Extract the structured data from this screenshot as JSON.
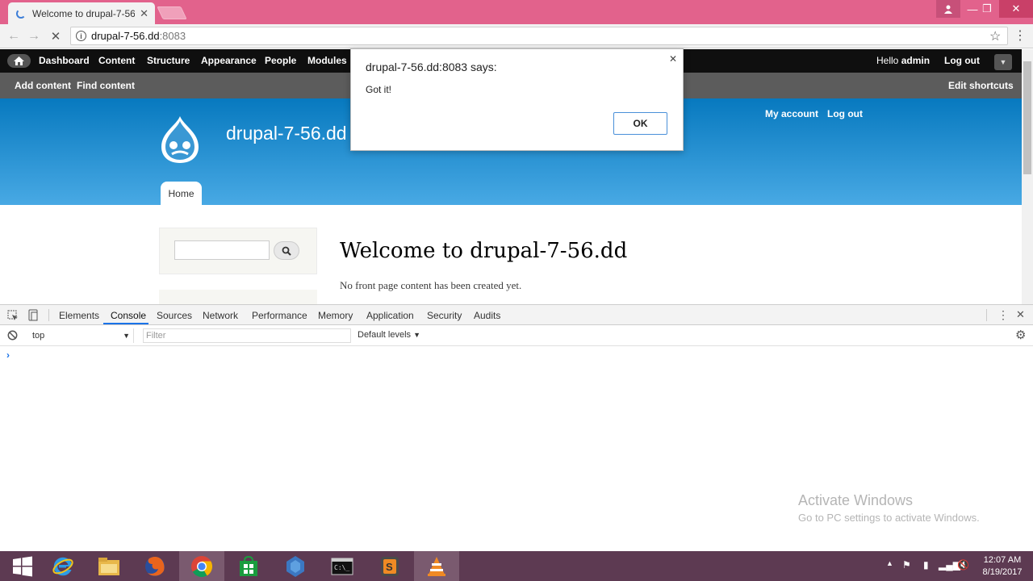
{
  "browser": {
    "tab_title": "Welcome to drupal-7-56",
    "url_host": "drupal-7-56.dd",
    "url_port": ":8083"
  },
  "admin_toolbar": {
    "items": [
      "Dashboard",
      "Content",
      "Structure",
      "Appearance",
      "People",
      "Modules"
    ],
    "hello": "Hello",
    "user": "admin",
    "logout": "Log out"
  },
  "shortcuts": {
    "add_content": "Add content",
    "find_content": "Find content",
    "edit_shortcuts": "Edit shortcuts"
  },
  "site": {
    "name": "drupal-7-56.dd",
    "my_account": "My account",
    "logout": "Log out",
    "home_tab": "Home",
    "heading": "Welcome to drupal-7-56.dd",
    "no_content": "No front page content has been created yet."
  },
  "alert": {
    "title": "drupal-7-56.dd:8083 says:",
    "message": "Got it!",
    "ok": "OK"
  },
  "devtools": {
    "tabs": [
      "Elements",
      "Console",
      "Sources",
      "Network",
      "Performance",
      "Memory",
      "Application",
      "Security",
      "Audits"
    ],
    "active_tab": "Console",
    "context": "top",
    "filter_placeholder": "Filter",
    "levels": "Default levels",
    "prompt": "›"
  },
  "watermark": {
    "line1": "Activate Windows",
    "line2": "Go to PC settings to activate Windows."
  },
  "taskbar": {
    "apps": [
      "windows-start-icon",
      "internet-explorer-icon",
      "file-explorer-icon",
      "firefox-icon",
      "chrome-icon",
      "store-icon",
      "vs-icon",
      "cmd-icon",
      "sublime-icon",
      "vlc-icon"
    ],
    "time": "12:07 AM",
    "date": "8/19/2017"
  },
  "colors": {
    "chrome_frame": "#e2628c",
    "drupal_blue": "#0779bf",
    "taskbar": "#5d3a52"
  }
}
